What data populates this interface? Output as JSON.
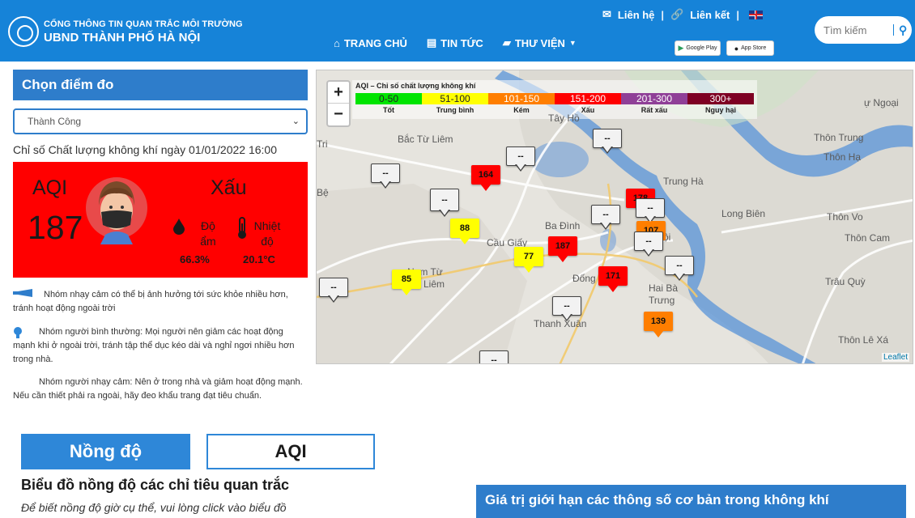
{
  "header": {
    "title_line1": "CỔNG THÔNG TIN QUAN TRẮC MÔI TRƯỜNG",
    "title_line2": "UBND THÀNH PHỐ HÀ NỘI",
    "contact": "Liên hệ",
    "links": "Liên kết",
    "separator": "|",
    "nav": [
      "TRANG CHỦ",
      "TIN TỨC",
      "THƯ VIỆN"
    ],
    "google_play": "Google Play",
    "app_store": "App Store",
    "search_placeholder": "Tìm kiếm",
    "brand_color": "#1683d8"
  },
  "panel": {
    "title": "Chọn điểm đo",
    "selected_station": "Thành Công",
    "caption": "Chỉ số Chất lượng không khí ngày 01/01/2022 16:00",
    "aqi_label": "AQI",
    "aqi_value": "187",
    "aqi_level": "Xấu",
    "aqi_color": "#ff0000",
    "humidity_label": "Độ ẩm",
    "humidity_value": "66.3%",
    "temperature_label": "Nhiệt độ",
    "temperature_value": "20.1°C",
    "advice": [
      "Nhóm nhạy cảm có thể bị ảnh hưởng tới sức khỏe nhiều hơn, tránh hoạt động ngoài trời",
      "Nhóm người bình thường: Mọi người nên giảm các hoạt động mạnh khi ở ngoài trời, tránh tập thể dục kéo dài và nghỉ ngơi nhiều hơn trong nhà.",
      "Nhóm người nhạy cảm: Nên ở trong nhà và giảm hoạt động mạnh. Nếu cần thiết phải ra ngoài, hãy đeo khẩu trang đạt tiêu chuẩn."
    ]
  },
  "tabs": {
    "concentration": "Nồng độ",
    "aqi": "AQI"
  },
  "chart_section": {
    "title": "Biểu đồ nồng độ các chỉ tiêu quan trắc",
    "hint": "Để biết nồng độ giờ cụ thể, vui lòng click vào biểu đồ"
  },
  "limits_section": {
    "title": "Giá trị giới hạn các thông số cơ bản trong không khí"
  },
  "map": {
    "zoom_in": "+",
    "zoom_out": "−",
    "legend_title": "AQI – Chỉ số chất lượng không khí",
    "legend": [
      {
        "range": "0-50",
        "label": "Tốt",
        "color": "#00e400"
      },
      {
        "range": "51-100",
        "label": "Trung bình",
        "color": "#ffff00"
      },
      {
        "range": "101-150",
        "label": "Kém",
        "color": "#ff7e00"
      },
      {
        "range": "151-200",
        "label": "Xấu",
        "color": "#ff0000"
      },
      {
        "range": "201-300",
        "label": "Rất xấu",
        "color": "#8f3f97"
      },
      {
        "range": "300+",
        "label": "Nguy hại",
        "color": "#7e0023"
      }
    ],
    "places": [
      "Tây Hồ",
      "Bắc Từ Liêm",
      "Trung Hà",
      "Ba Đình",
      "Cầu Giấy",
      "Nam Từ",
      "Liêm",
      "Đống",
      "Hai Bà",
      "Trưng",
      "Thanh Xuân",
      "Long Biên",
      "Thôn Trung",
      "Thôn Hạ",
      "Thôn Vo",
      "Thôn Cam",
      "Trâu Quỳ",
      "Thôn Lê Xá",
      "ự Ngoại",
      "Tri",
      "Bệ",
      "ội"
    ],
    "markers": [
      "--",
      "164",
      "--",
      "--",
      "88",
      "--",
      "178",
      "--",
      "107",
      "--",
      "187",
      "77",
      "--",
      "85",
      "--",
      "171",
      "--",
      "--",
      "139",
      "--",
      "--"
    ],
    "attribution": "Leaflet"
  }
}
